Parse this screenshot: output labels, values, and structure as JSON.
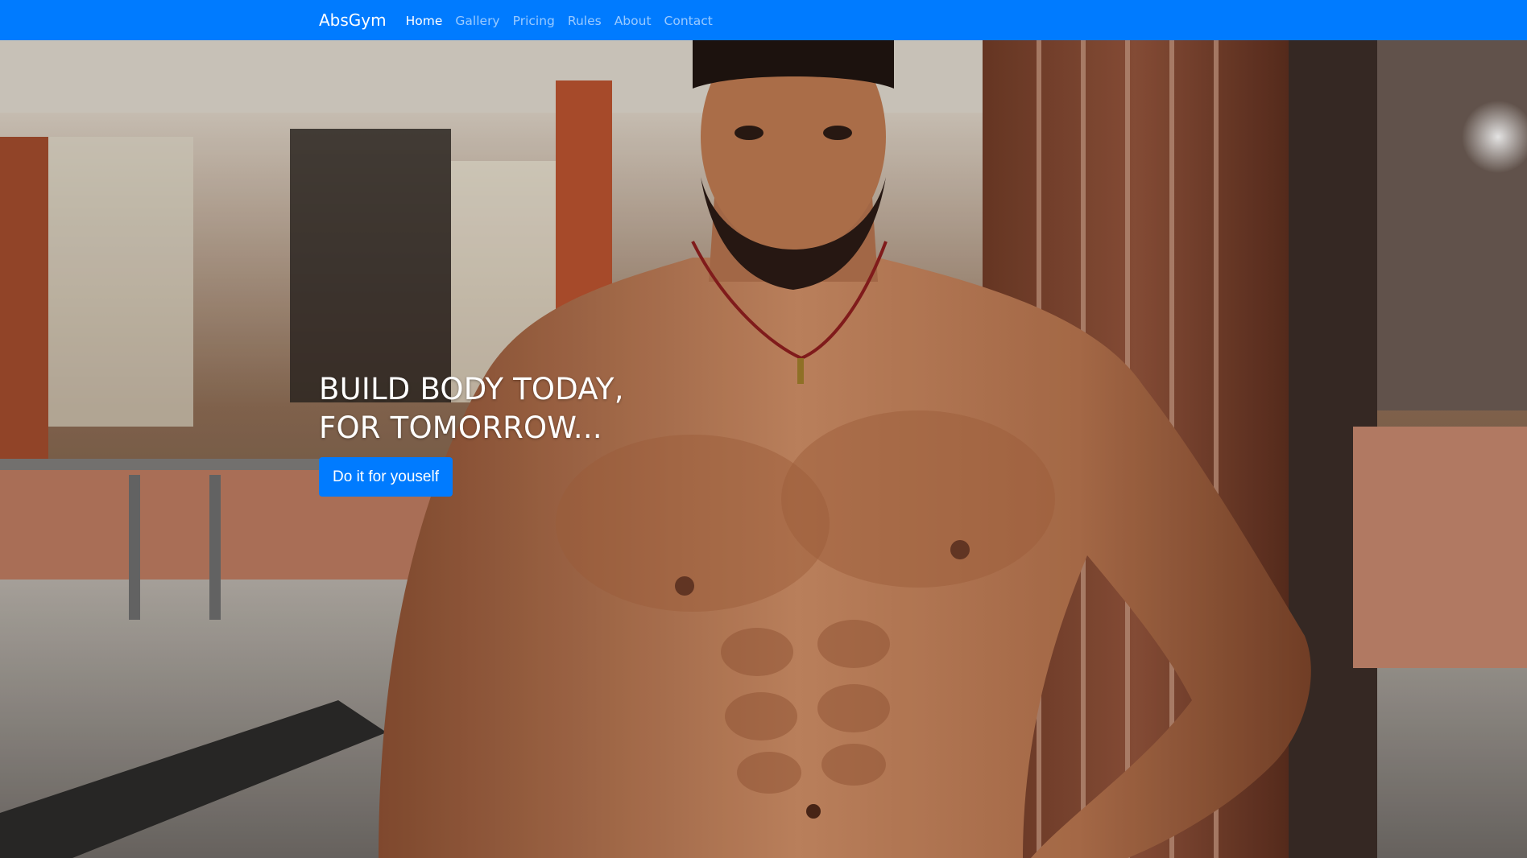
{
  "navbar": {
    "brand": "AbsGym",
    "links": [
      {
        "label": "Home",
        "active": true
      },
      {
        "label": "Gallery",
        "active": false
      },
      {
        "label": "Pricing",
        "active": false
      },
      {
        "label": "Rules",
        "active": false
      },
      {
        "label": "About",
        "active": false
      },
      {
        "label": "Contact",
        "active": false
      }
    ],
    "color": "#007bff"
  },
  "hero": {
    "title_line1": "BUILD BODY TODAY,",
    "title_line2": "FOR TOMORROW...",
    "button_label": "Do it for youself",
    "button_color": "#007bff"
  }
}
